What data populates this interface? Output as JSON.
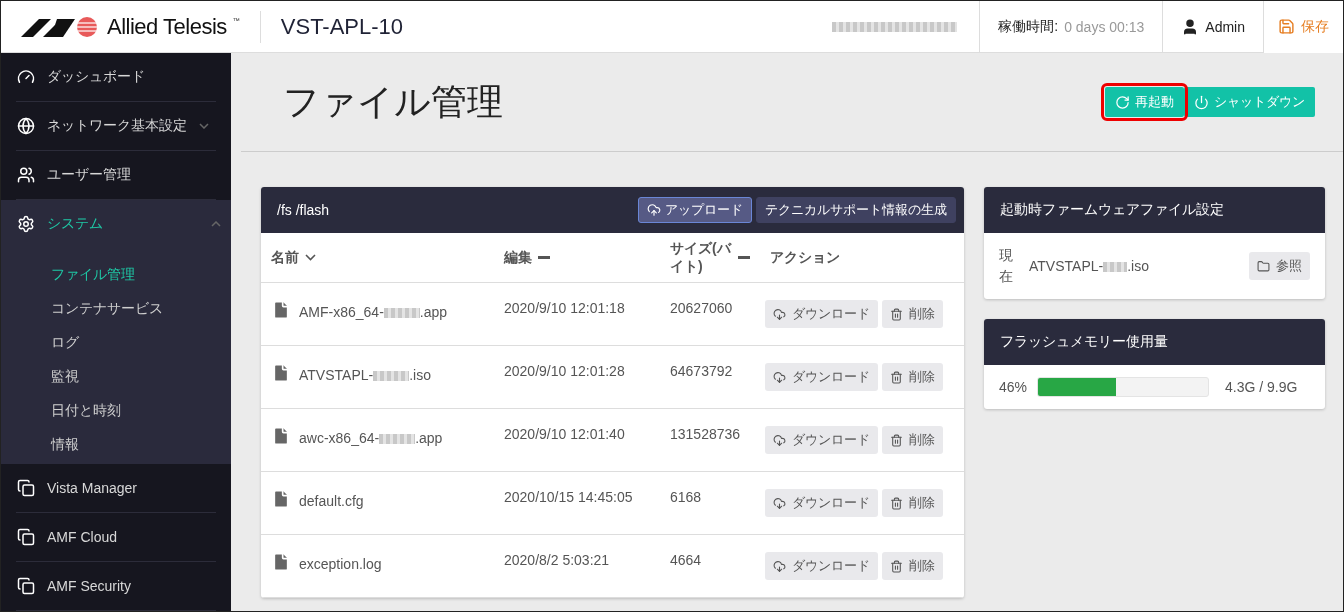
{
  "header": {
    "brand": "Allied Telesis",
    "tm": "™",
    "device": "VST-APL-10",
    "serial_redacted": true,
    "uptime_label": "稼働時間:",
    "uptime_value": "0 days 00:13",
    "user": "Admin",
    "save": "保存"
  },
  "sidebar": {
    "items": [
      {
        "label": "ダッシュボード",
        "selected": false
      },
      {
        "label": "ネットワーク基本設定",
        "selected": false,
        "expanded": false
      },
      {
        "label": "ユーザー管理",
        "selected": false
      },
      {
        "label": "システム",
        "selected": true,
        "expanded": true,
        "children": [
          {
            "label": "ファイル管理",
            "selected": true
          },
          {
            "label": "コンテナサービス",
            "selected": false
          },
          {
            "label": "ログ",
            "selected": false
          },
          {
            "label": "監視",
            "selected": false
          },
          {
            "label": "日付と時刻",
            "selected": false
          },
          {
            "label": "情報",
            "selected": false
          }
        ]
      },
      {
        "label": "Vista Manager",
        "selected": false
      },
      {
        "label": "AMF Cloud",
        "selected": false
      },
      {
        "label": "AMF Security",
        "selected": false
      }
    ]
  },
  "page": {
    "title": "ファイル管理",
    "buttons": [
      {
        "label": "再起動",
        "highlighted": true
      },
      {
        "label": "シャットダウン",
        "highlighted": false
      }
    ]
  },
  "files": {
    "path": "/fs /flash",
    "upload": "アップロード",
    "support": "テクニカルサポート情報の生成",
    "columns": [
      {
        "label": "名前",
        "sorted": true
      },
      {
        "label": "編集",
        "sorted": false
      },
      {
        "label": "サイズ(バイト)",
        "sorted": false
      },
      {
        "label": "アクション"
      }
    ],
    "rows": [
      {
        "name_prefix": "AMF-x86_64-",
        "redacted": true,
        "name_suffix": ".app",
        "modified": "2020/9/10 12:01:18",
        "size": "20627060",
        "download": "ダウンロード",
        "delete": "削除"
      },
      {
        "name_prefix": "ATVSTAPL-",
        "redacted": true,
        "name_suffix": ".iso",
        "modified": "2020/9/10 12:01:28",
        "size": "64673792",
        "download": "ダウンロード",
        "delete": "削除"
      },
      {
        "name_prefix": "awc-x86_64-",
        "redacted": true,
        "name_suffix": ".app",
        "modified": "2020/9/10 12:01:40",
        "size": "131528736",
        "download": "ダウンロード",
        "delete": "削除"
      },
      {
        "name_prefix": "default.cfg",
        "name_suffix": "",
        "modified": "2020/10/15 14:45:05",
        "size": "6168",
        "download": "ダウンロード",
        "delete": "削除"
      },
      {
        "name_prefix": "exception.log",
        "name_suffix": "",
        "modified": "2020/8/2 5:03:21",
        "size": "4664",
        "download": "ダウンロード",
        "delete": "削除"
      }
    ]
  },
  "firmware": {
    "title": "起動時ファームウェアファイル設定",
    "label": "現在",
    "file_prefix": "ATVSTAPL-",
    "redacted": true,
    "file_suffix": ".iso",
    "browse": "参照"
  },
  "memory": {
    "title": "フラッシュメモリー使用量",
    "percent": "46%",
    "level": 0.46,
    "usage": "4.3G / 9.9G"
  }
}
